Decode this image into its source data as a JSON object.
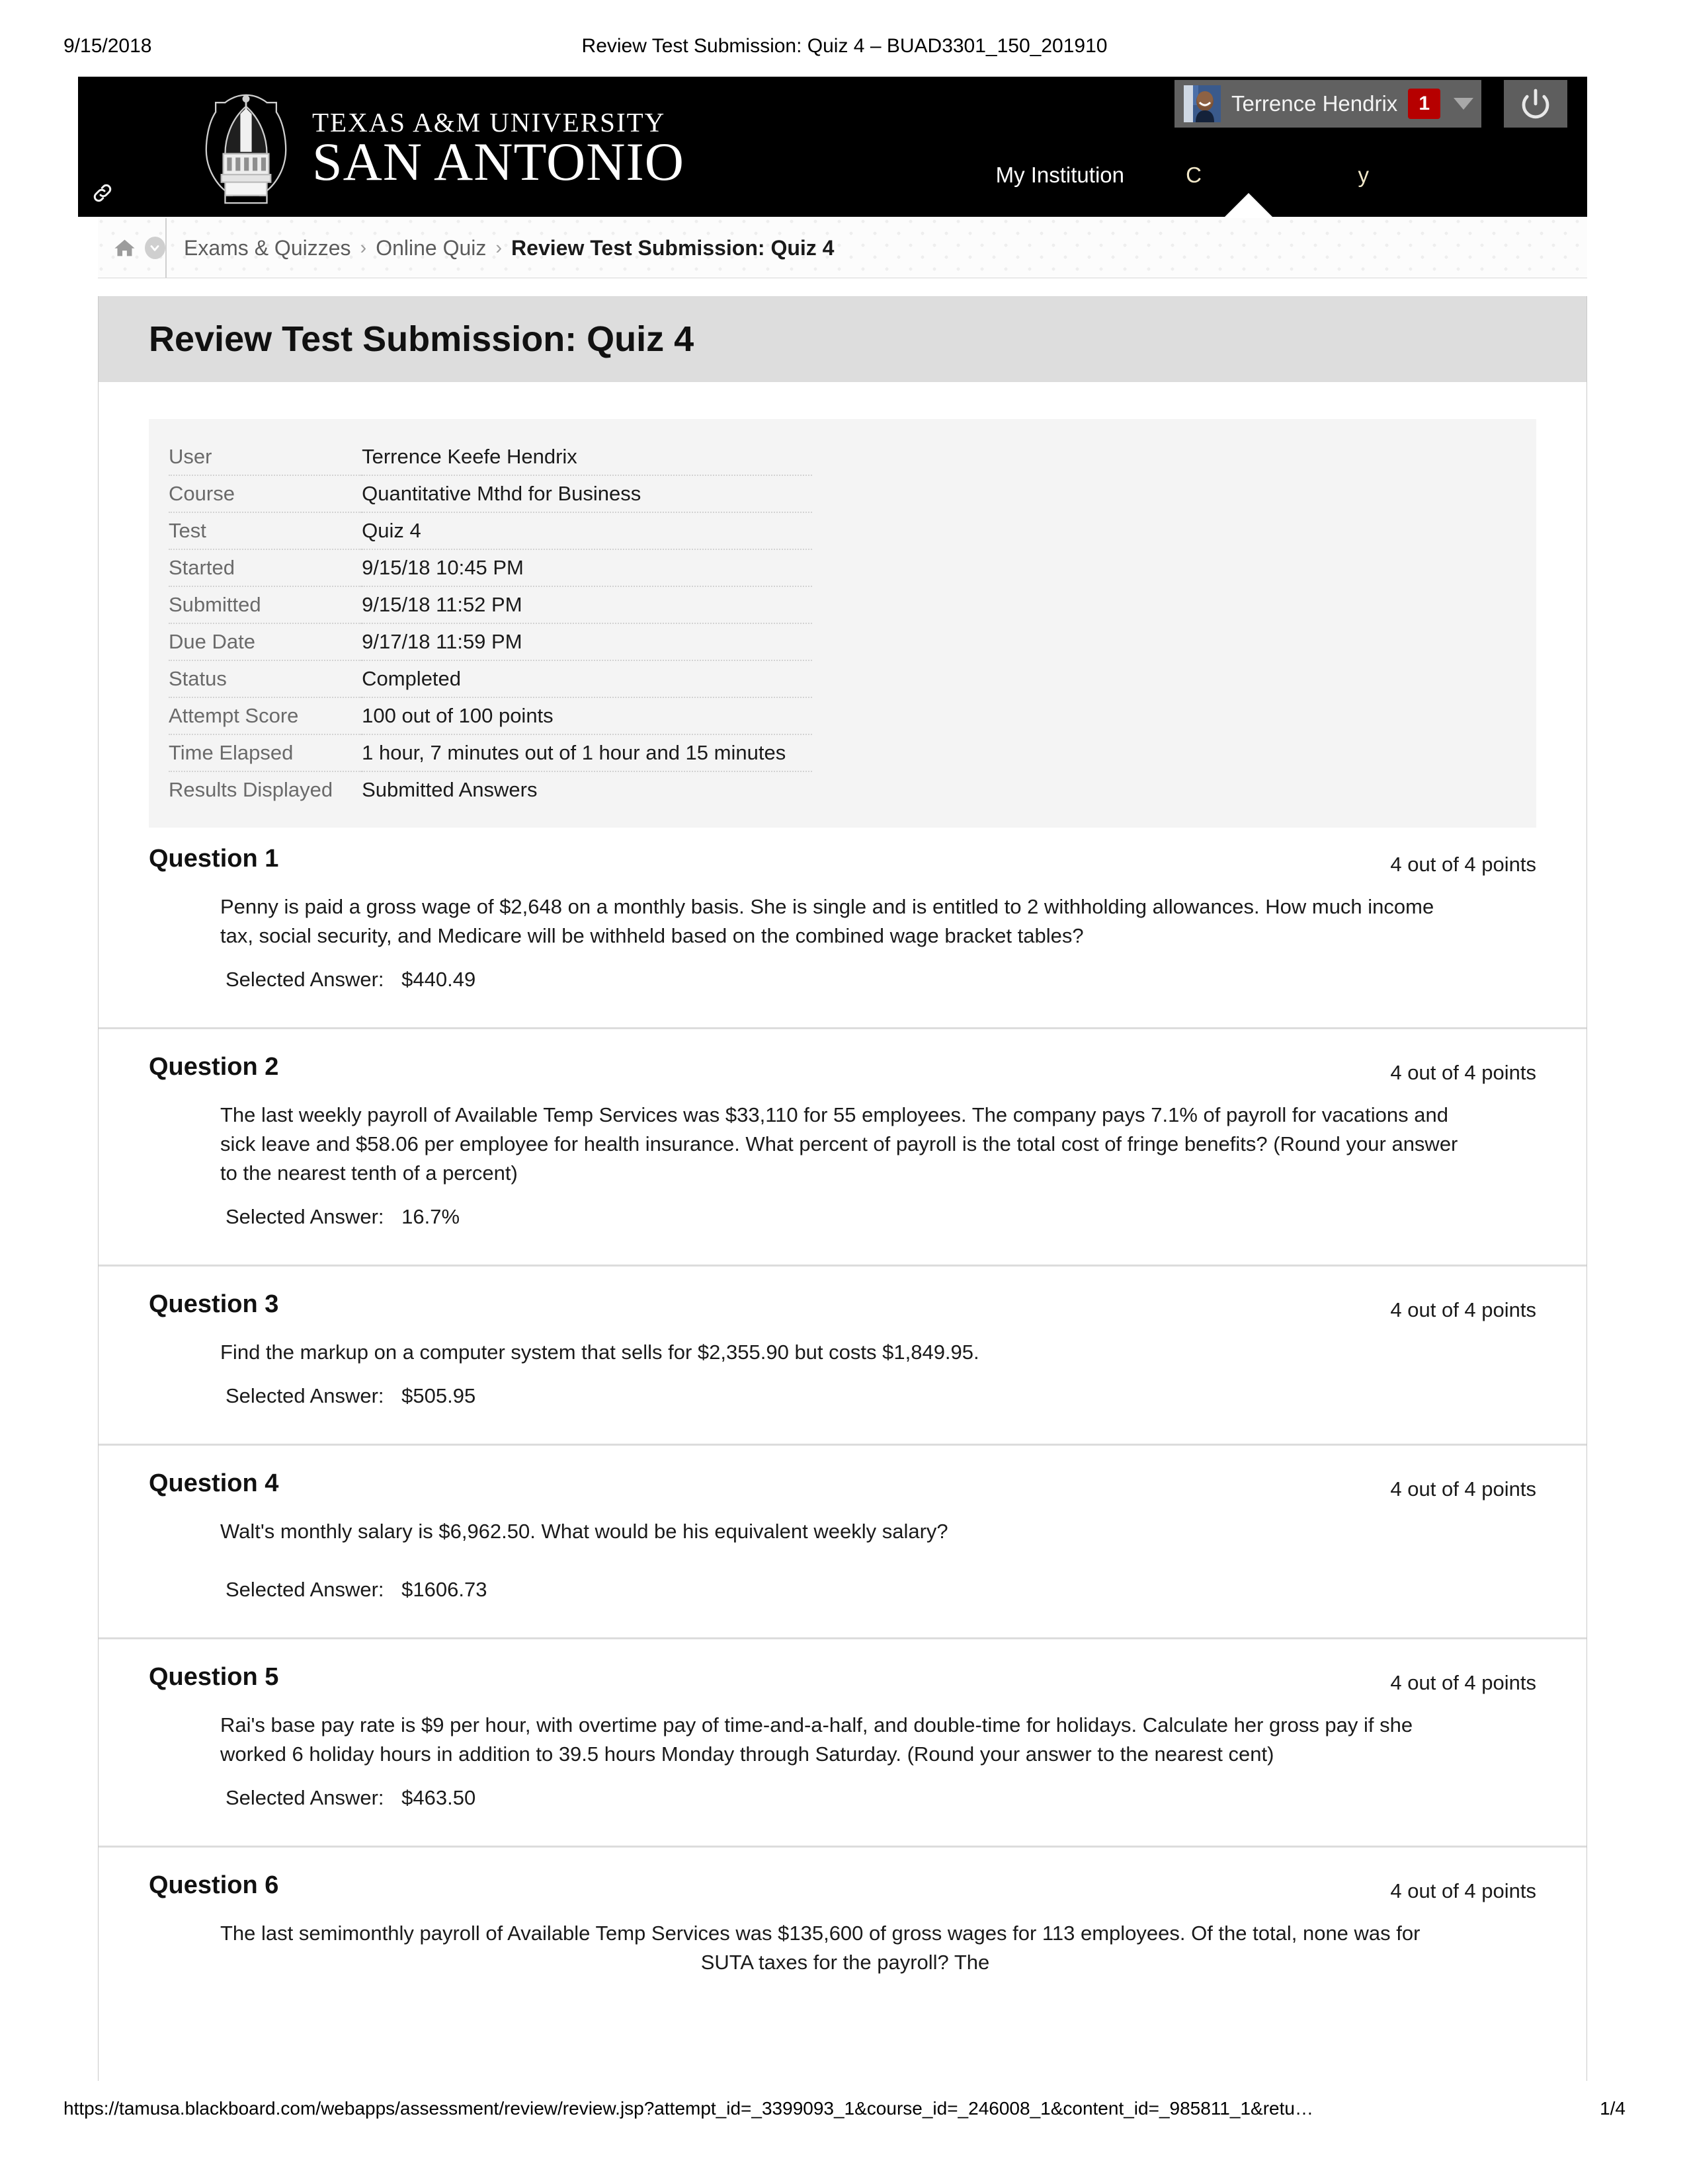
{
  "print": {
    "date": "9/15/2018",
    "title": "Review Test Submission: Quiz 4 – BUAD3301_150_201910",
    "footer_url": "https://tamusa.blackboard.com/webapps/assessment/review/review.jsp?attempt_id=_3399093_1&course_id=_246008_1&content_id=_985811_1&retu…",
    "footer_page": "1/4"
  },
  "topbar": {
    "logo_line1": "TEXAS A&M UNIVERSITY",
    "logo_line2": "SAN ANTONIO",
    "logo_icon": "dome-emblem-icon",
    "link_icon": "link-chain-icon",
    "nav": {
      "my_institution": "My Institution",
      "courses": "C",
      "my_grades": "y"
    },
    "user_menu": {
      "name": "Terrence Hendrix",
      "badge_count": "1",
      "avatar_icon": "user-avatar",
      "chevron_icon": "chevron-down-icon"
    },
    "power_icon": "power-logout-icon",
    "colors": {
      "bar_bg": "#000000",
      "menu_bg": "#616161",
      "badge": "#b60000",
      "nav_link": "#f2e8c9"
    }
  },
  "breadcrumb": {
    "home_icon": "home-icon",
    "expand_icon": "circle-chevron-down-icon",
    "separator": "›",
    "items": [
      {
        "label": "Exams & Quizzes",
        "current": false
      },
      {
        "label": "Online Quiz",
        "current": false
      },
      {
        "label": "Review Test Submission: Quiz 4",
        "current": true
      }
    ]
  },
  "page": {
    "title": "Review Test Submission: Quiz 4"
  },
  "info": {
    "rows": [
      {
        "label": "User",
        "value": "Terrence Keefe Hendrix"
      },
      {
        "label": "Course",
        "value": "Quantitative Mthd for Business"
      },
      {
        "label": "Test",
        "value": "Quiz 4"
      },
      {
        "label": "Started",
        "value": "9/15/18 10:45 PM"
      },
      {
        "label": "Submitted",
        "value": "9/15/18 11:52 PM"
      },
      {
        "label": "Due Date",
        "value": "9/17/18 11:59 PM"
      },
      {
        "label": "Status",
        "value": "Completed"
      },
      {
        "label": "Attempt Score",
        "value": "100 out of 100 points"
      },
      {
        "label": "Time Elapsed",
        "value": "1 hour, 7 minutes out of 1 hour and 15 minutes"
      },
      {
        "label": "Results Displayed",
        "value": "Submitted Answers"
      }
    ]
  },
  "answer_label": "Selected Answer:",
  "questions": [
    {
      "title": "Question 1",
      "points": "4 out of 4 points",
      "text": "Penny is paid a gross wage of $2,648 on a monthly basis. She is single and is entitled to 2 withholding allowances. How much income tax, social security, and Medicare will be withheld based on the combined wage bracket tables?",
      "answer": "$440.49"
    },
    {
      "title": "Question 2",
      "points": "4 out of 4 points",
      "text": "The last weekly payroll of Available Temp Services was $33,110 for 55 employees. The company pays 7.1% of payroll for vacations and sick leave and $58.06 per employee for health insurance. What percent of payroll is the total cost of fringe benefits? (Round your answer to the nearest tenth of a percent)",
      "answer": "16.7%"
    },
    {
      "title": "Question 3",
      "points": "4 out of 4 points",
      "text": "Find the markup on a computer system that sells for $2,355.90 but costs $1,849.95.",
      "answer": "$505.95"
    },
    {
      "title": "Question 4",
      "points": "4 out of 4 points",
      "text": "Walt's monthly salary is $6,962.50. What would be his equivalent weekly salary?",
      "answer": "$1606.73"
    },
    {
      "title": "Question 5",
      "points": "4 out of 4 points",
      "text": "Rai's base pay rate is $9 per hour, with overtime pay of time-and-a-half, and double-time for holidays. Calculate her gross pay if she worked 6 holiday hours in addition to 39.5 hours Monday through Saturday. (Round your answer to the nearest cent)",
      "answer": "$463.50"
    }
  ],
  "question6": {
    "title": "Question 6",
    "points": "4 out of 4 points",
    "text_line1": "The last semimonthly payroll of Available Temp Services was $135,600 of gross wages for 113 employees. Of the total, none was for",
    "text_line2": "SUTA taxes for the payroll? The"
  }
}
